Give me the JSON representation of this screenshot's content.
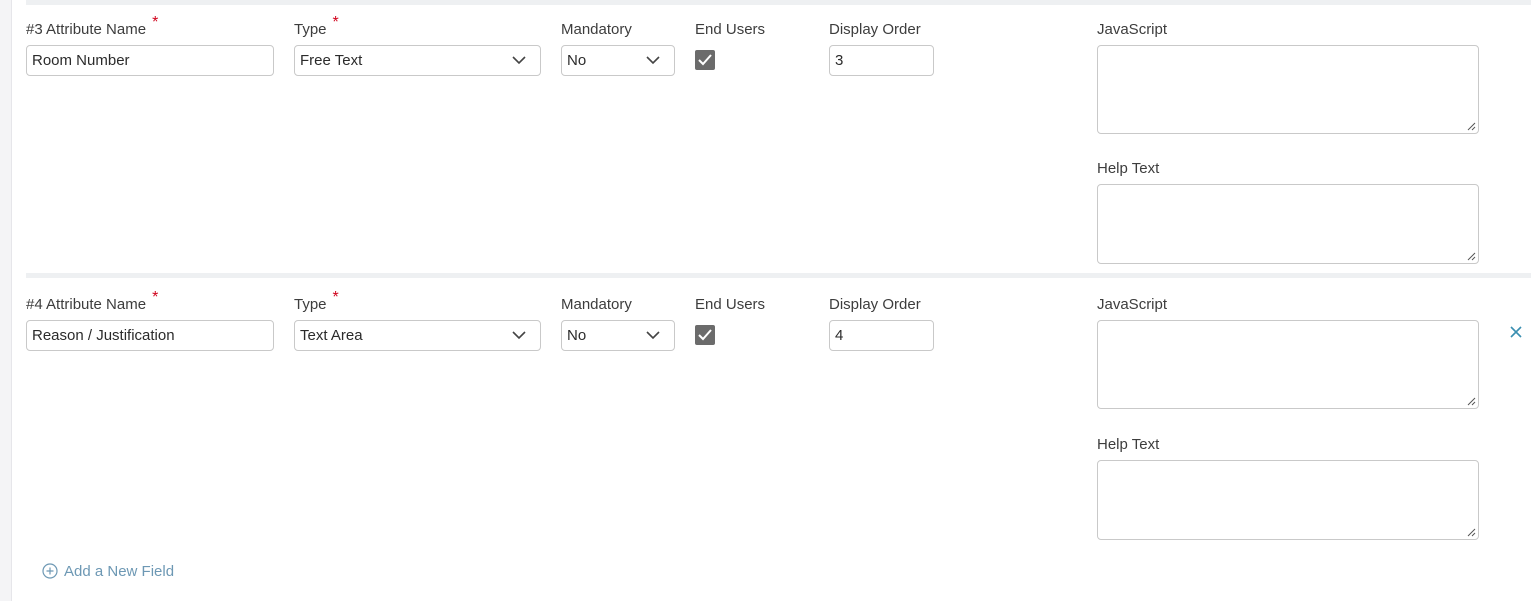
{
  "rows": [
    {
      "attribute_label": "#3 Attribute Name",
      "attribute_value": "Room Number",
      "type_label": "Type",
      "type_value": "Free Text",
      "mandatory_label": "Mandatory",
      "mandatory_value": "No",
      "end_users_label": "End Users",
      "end_users_checked": true,
      "display_order_label": "Display Order",
      "display_order_value": "3",
      "javascript_label": "JavaScript",
      "javascript_value": "",
      "help_text_label": "Help Text",
      "help_text_value": ""
    },
    {
      "attribute_label": "#4 Attribute Name",
      "attribute_value": "Reason / Justification",
      "type_label": "Type",
      "type_value": "Text Area",
      "mandatory_label": "Mandatory",
      "mandatory_value": "No",
      "end_users_label": "End Users",
      "end_users_checked": true,
      "display_order_label": "Display Order",
      "display_order_value": "4",
      "javascript_label": "JavaScript",
      "javascript_value": "",
      "help_text_label": "Help Text",
      "help_text_value": "",
      "remove_icon": "close-icon"
    }
  ],
  "required_marker": "*",
  "add_field": {
    "icon": "plus-circle-icon",
    "label": "Add a New Field"
  },
  "colors": {
    "required": "#d0021b",
    "accent": "#6d98b4",
    "remove": "#3a8fb0",
    "checkbox": "#6b6b6b"
  }
}
